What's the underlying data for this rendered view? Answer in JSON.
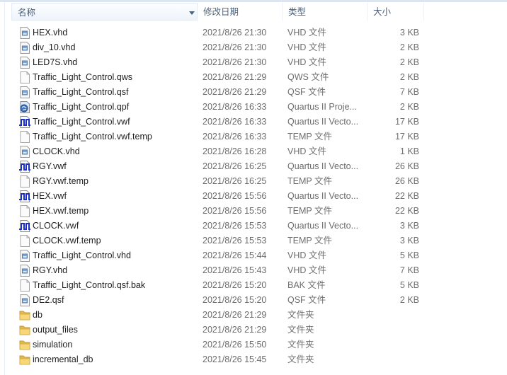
{
  "columns": {
    "name": "名称",
    "date": "修改日期",
    "type": "类型",
    "size": "大小"
  },
  "files": [
    {
      "name": "HEX.vhd",
      "date": "2021/8/26 21:30",
      "type": "VHD 文件",
      "size": "3 KB",
      "icon": "vhd-file-icon"
    },
    {
      "name": "div_10.vhd",
      "date": "2021/8/26 21:30",
      "type": "VHD 文件",
      "size": "2 KB",
      "icon": "vhd-file-icon"
    },
    {
      "name": "LED7S.vhd",
      "date": "2021/8/26 21:30",
      "type": "VHD 文件",
      "size": "2 KB",
      "icon": "vhd-file-icon"
    },
    {
      "name": "Traffic_Light_Control.qws",
      "date": "2021/8/26 21:29",
      "type": "QWS 文件",
      "size": "2 KB",
      "icon": "blank-file-icon"
    },
    {
      "name": "Traffic_Light_Control.qsf",
      "date": "2021/8/26 21:29",
      "type": "QSF 文件",
      "size": "7 KB",
      "icon": "vhd-file-icon"
    },
    {
      "name": "Traffic_Light_Control.qpf",
      "date": "2021/8/26 16:33",
      "type": "Quartus II Proje...",
      "size": "2 KB",
      "icon": "quartus-project-icon"
    },
    {
      "name": "Traffic_Light_Control.vwf",
      "date": "2021/8/26 16:33",
      "type": "Quartus II Vecto...",
      "size": "17 KB",
      "icon": "waveform-file-icon"
    },
    {
      "name": "Traffic_Light_Control.vwf.temp",
      "date": "2021/8/26 16:33",
      "type": "TEMP 文件",
      "size": "17 KB",
      "icon": "blank-file-icon"
    },
    {
      "name": "CLOCK.vhd",
      "date": "2021/8/26 16:28",
      "type": "VHD 文件",
      "size": "1 KB",
      "icon": "vhd-file-icon"
    },
    {
      "name": "RGY.vwf",
      "date": "2021/8/26 16:25",
      "type": "Quartus II Vecto...",
      "size": "26 KB",
      "icon": "waveform-file-icon"
    },
    {
      "name": "RGY.vwf.temp",
      "date": "2021/8/26 16:25",
      "type": "TEMP 文件",
      "size": "26 KB",
      "icon": "blank-file-icon"
    },
    {
      "name": "HEX.vwf",
      "date": "2021/8/26 15:56",
      "type": "Quartus II Vecto...",
      "size": "22 KB",
      "icon": "waveform-file-icon"
    },
    {
      "name": "HEX.vwf.temp",
      "date": "2021/8/26 15:56",
      "type": "TEMP 文件",
      "size": "22 KB",
      "icon": "blank-file-icon"
    },
    {
      "name": "CLOCK.vwf",
      "date": "2021/8/26 15:53",
      "type": "Quartus II Vecto...",
      "size": "3 KB",
      "icon": "waveform-file-icon"
    },
    {
      "name": "CLOCK.vwf.temp",
      "date": "2021/8/26 15:53",
      "type": "TEMP 文件",
      "size": "3 KB",
      "icon": "blank-file-icon"
    },
    {
      "name": "Traffic_Light_Control.vhd",
      "date": "2021/8/26 15:44",
      "type": "VHD 文件",
      "size": "5 KB",
      "icon": "vhd-file-icon"
    },
    {
      "name": "RGY.vhd",
      "date": "2021/8/26 15:43",
      "type": "VHD 文件",
      "size": "7 KB",
      "icon": "vhd-file-icon"
    },
    {
      "name": "Traffic_Light_Control.qsf.bak",
      "date": "2021/8/26 15:20",
      "type": "BAK 文件",
      "size": "5 KB",
      "icon": "blank-file-icon"
    },
    {
      "name": "DE2.qsf",
      "date": "2021/8/26 15:20",
      "type": "QSF 文件",
      "size": "2 KB",
      "icon": "vhd-file-icon"
    },
    {
      "name": "db",
      "date": "2021/8/26 21:29",
      "type": "文件夹",
      "size": "",
      "icon": "folder-icon"
    },
    {
      "name": "output_files",
      "date": "2021/8/26 21:29",
      "type": "文件夹",
      "size": "",
      "icon": "folder-icon"
    },
    {
      "name": "simulation",
      "date": "2021/8/26 15:50",
      "type": "文件夹",
      "size": "",
      "icon": "folder-icon"
    },
    {
      "name": "incremental_db",
      "date": "2021/8/26 15:45",
      "type": "文件夹",
      "size": "",
      "icon": "folder-icon"
    }
  ]
}
